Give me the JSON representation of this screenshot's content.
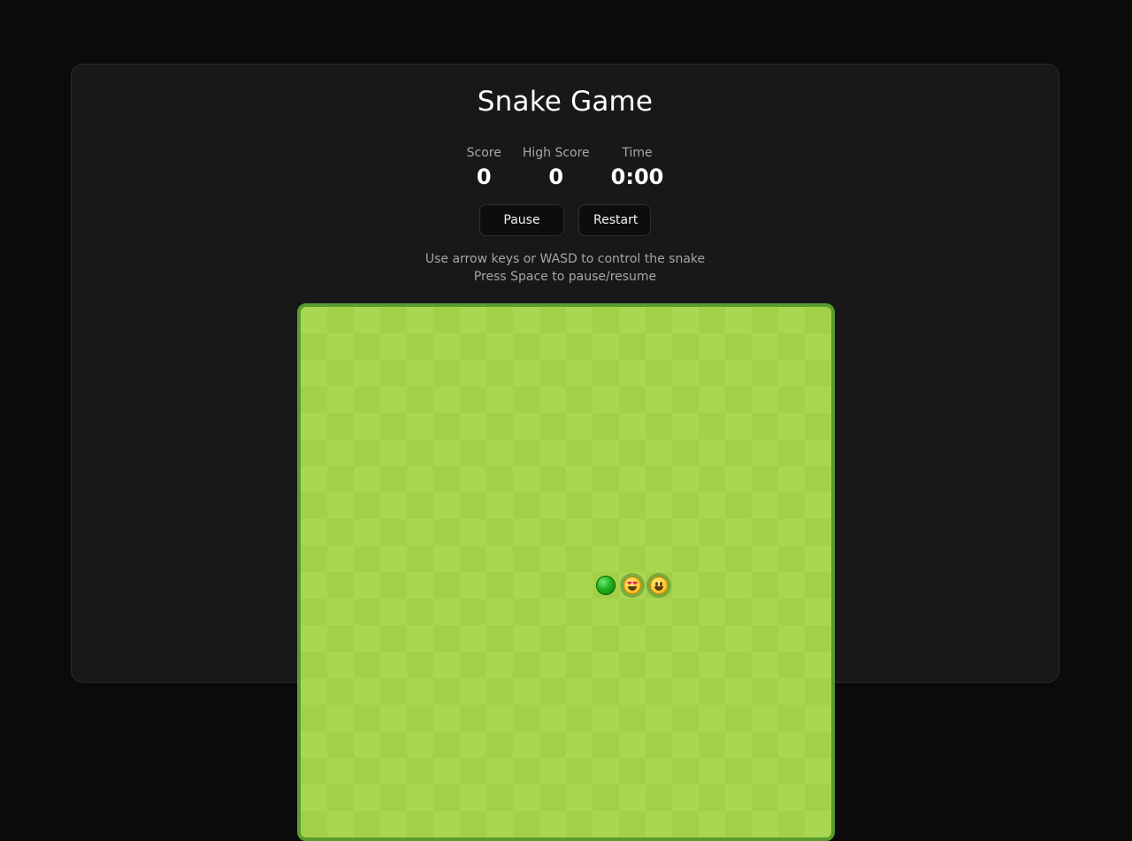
{
  "title": "Snake Game",
  "stats": {
    "score_label": "Score",
    "score_value": "0",
    "high_score_label": "High Score",
    "high_score_value": "0",
    "time_label": "Time",
    "time_value": "0:00"
  },
  "controls": {
    "pause_label": "Pause",
    "restart_label": "Restart"
  },
  "help": {
    "line1": "Use arrow keys or WASD to control the snake",
    "line2": "Press Space to pause/resume"
  },
  "board": {
    "grid_color_light": "#a9d751",
    "grid_color_dark": "#a2d149",
    "border_color": "#5a9b2f",
    "snake": [
      {
        "part": "tail",
        "icon": "green-ball-icon"
      },
      {
        "part": "body",
        "icon": "heart-eyes-face-icon"
      },
      {
        "part": "head",
        "icon": "grinning-face-icon"
      }
    ]
  }
}
